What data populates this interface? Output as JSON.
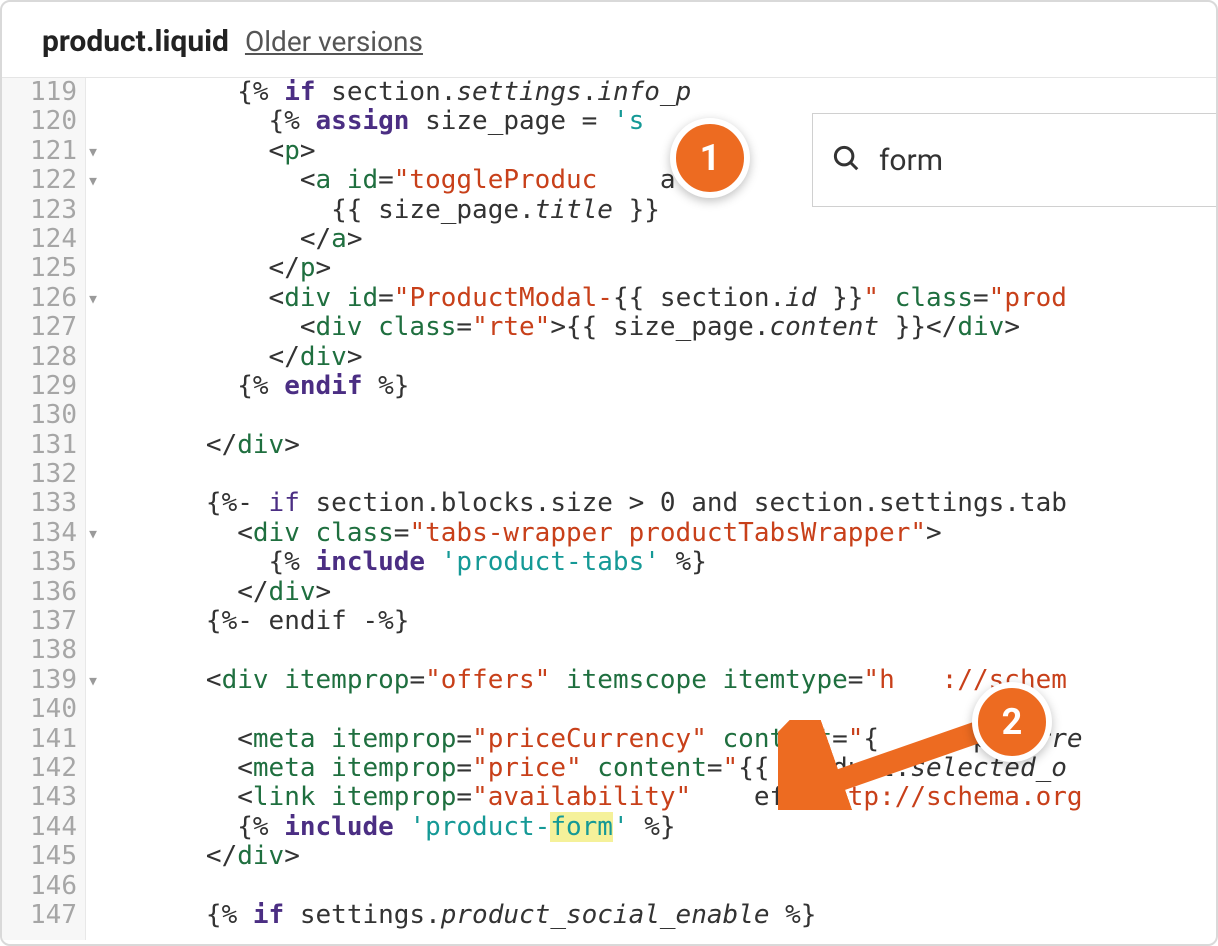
{
  "header": {
    "filename": "product.liquid",
    "older_versions": "Older versions"
  },
  "search": {
    "value": "form"
  },
  "annotations": {
    "badge1": "1",
    "badge2": "2"
  },
  "gutter": {
    "start": 119,
    "end": 147,
    "fold_arrows": [
      121,
      122,
      126,
      134,
      139
    ]
  },
  "code": {
    "lines": [
      {
        "n": 119,
        "indent": 8,
        "tokens": [
          [
            "ang",
            "{% "
          ],
          [
            "kw",
            "if"
          ],
          [
            "ang",
            " section."
          ],
          [
            "prop",
            "settings"
          ],
          [
            "ang",
            "."
          ],
          [
            "prop",
            "info_p"
          ]
        ]
      },
      {
        "n": 120,
        "indent": 10,
        "tokens": [
          [
            "ang",
            "{% "
          ],
          [
            "kw",
            "assign"
          ],
          [
            "ang",
            " size_page = "
          ],
          [
            "str2",
            "'s"
          ]
        ]
      },
      {
        "n": 121,
        "indent": 10,
        "tokens": [
          [
            "ang",
            "<"
          ],
          [
            "tag",
            "p"
          ],
          [
            "ang",
            ">"
          ]
        ]
      },
      {
        "n": 122,
        "indent": 12,
        "tokens": [
          [
            "ang",
            "<"
          ],
          [
            "tag",
            "a"
          ],
          [
            "ang",
            " "
          ],
          [
            "attr",
            "id"
          ],
          [
            "ang",
            "="
          ],
          [
            "str",
            "\"toggleProduc"
          ],
          [
            "ang",
            "    al-"
          ]
        ]
      },
      {
        "n": 123,
        "indent": 14,
        "tokens": [
          [
            "ang",
            "{{ size_page."
          ],
          [
            "prop",
            "title"
          ],
          [
            "ang",
            " }}"
          ]
        ]
      },
      {
        "n": 124,
        "indent": 12,
        "tokens": [
          [
            "ang",
            "</"
          ],
          [
            "tag",
            "a"
          ],
          [
            "ang",
            ">"
          ]
        ]
      },
      {
        "n": 125,
        "indent": 10,
        "tokens": [
          [
            "ang",
            "</"
          ],
          [
            "tag",
            "p"
          ],
          [
            "ang",
            ">"
          ]
        ]
      },
      {
        "n": 126,
        "indent": 10,
        "tokens": [
          [
            "ang",
            "<"
          ],
          [
            "tag",
            "div"
          ],
          [
            "ang",
            " "
          ],
          [
            "attr",
            "id"
          ],
          [
            "ang",
            "="
          ],
          [
            "str",
            "\"ProductModal-"
          ],
          [
            "ang",
            "{{ section."
          ],
          [
            "prop",
            "id"
          ],
          [
            "ang",
            " }}"
          ],
          [
            "str",
            "\""
          ],
          [
            "ang",
            " "
          ],
          [
            "attr",
            "class"
          ],
          [
            "ang",
            "="
          ],
          [
            "str",
            "\"prod"
          ]
        ]
      },
      {
        "n": 127,
        "indent": 12,
        "tokens": [
          [
            "ang",
            "<"
          ],
          [
            "tag",
            "div"
          ],
          [
            "ang",
            " "
          ],
          [
            "attr",
            "class"
          ],
          [
            "ang",
            "="
          ],
          [
            "str",
            "\"rte\""
          ],
          [
            "ang",
            ">{{ size_page."
          ],
          [
            "prop",
            "content"
          ],
          [
            "ang",
            " }}</"
          ],
          [
            "tag",
            "div"
          ],
          [
            "ang",
            ">"
          ]
        ]
      },
      {
        "n": 128,
        "indent": 10,
        "tokens": [
          [
            "ang",
            "</"
          ],
          [
            "tag",
            "div"
          ],
          [
            "ang",
            ">"
          ]
        ]
      },
      {
        "n": 129,
        "indent": 8,
        "tokens": [
          [
            "ang",
            "{% "
          ],
          [
            "kw",
            "endif"
          ],
          [
            "ang",
            " %}"
          ]
        ]
      },
      {
        "n": 130,
        "indent": 0,
        "tokens": []
      },
      {
        "n": 131,
        "indent": 6,
        "tokens": [
          [
            "ang",
            "</"
          ],
          [
            "tag",
            "div"
          ],
          [
            "ang",
            ">"
          ]
        ]
      },
      {
        "n": 132,
        "indent": 0,
        "tokens": []
      },
      {
        "n": 133,
        "indent": 6,
        "tokens": [
          [
            "ang",
            "{%- "
          ],
          [
            "lt",
            "if"
          ],
          [
            "ang",
            " section.blocks.size > 0 and section.settings.tab"
          ]
        ]
      },
      {
        "n": 134,
        "indent": 8,
        "tokens": [
          [
            "ang",
            "<"
          ],
          [
            "tag",
            "div"
          ],
          [
            "ang",
            " "
          ],
          [
            "attr",
            "class"
          ],
          [
            "ang",
            "="
          ],
          [
            "str",
            "\"tabs-wrapper productTabsWrapper\""
          ],
          [
            "ang",
            ">"
          ]
        ]
      },
      {
        "n": 135,
        "indent": 10,
        "tokens": [
          [
            "ang",
            "{% "
          ],
          [
            "kw",
            "include"
          ],
          [
            "ang",
            " "
          ],
          [
            "str2",
            "'product-tabs'"
          ],
          [
            "ang",
            " %}"
          ]
        ]
      },
      {
        "n": 136,
        "indent": 8,
        "tokens": [
          [
            "ang",
            "</"
          ],
          [
            "tag",
            "div"
          ],
          [
            "ang",
            ">"
          ]
        ]
      },
      {
        "n": 137,
        "indent": 6,
        "tokens": [
          [
            "ang",
            "{%- endif -%}"
          ]
        ]
      },
      {
        "n": 138,
        "indent": 0,
        "tokens": []
      },
      {
        "n": 139,
        "indent": 6,
        "tokens": [
          [
            "ang",
            "<"
          ],
          [
            "tag",
            "div"
          ],
          [
            "ang",
            " "
          ],
          [
            "attr",
            "itemprop"
          ],
          [
            "ang",
            "="
          ],
          [
            "str",
            "\"offers\""
          ],
          [
            "ang",
            " "
          ],
          [
            "attr",
            "itemscope"
          ],
          [
            "ang",
            " "
          ],
          [
            "attr",
            "itemtype"
          ],
          [
            "ang",
            "="
          ],
          [
            "str",
            "\"h   ://schem"
          ]
        ]
      },
      {
        "n": 140,
        "indent": 0,
        "tokens": []
      },
      {
        "n": 141,
        "indent": 8,
        "tokens": [
          [
            "ang",
            "<"
          ],
          [
            "tag",
            "meta"
          ],
          [
            "ang",
            " "
          ],
          [
            "attr",
            "itemprop"
          ],
          [
            "ang",
            "="
          ],
          [
            "str",
            "\"priceCurrency\""
          ],
          [
            "ang",
            " "
          ],
          [
            "attr",
            "content"
          ],
          [
            "ang",
            "="
          ],
          [
            "str",
            "\""
          ],
          [
            "ang",
            "{      p."
          ],
          [
            "prop",
            "curre"
          ]
        ]
      },
      {
        "n": 142,
        "indent": 8,
        "tokens": [
          [
            "ang",
            "<"
          ],
          [
            "tag",
            "meta"
          ],
          [
            "ang",
            " "
          ],
          [
            "attr",
            "itemprop"
          ],
          [
            "ang",
            "="
          ],
          [
            "str",
            "\"price\""
          ],
          [
            "ang",
            " "
          ],
          [
            "attr",
            "content"
          ],
          [
            "ang",
            "="
          ],
          [
            "str",
            "\""
          ],
          [
            "ang",
            "{{  roduct."
          ],
          [
            "prop",
            "selected_o"
          ]
        ]
      },
      {
        "n": 143,
        "indent": 8,
        "tokens": [
          [
            "ang",
            "<"
          ],
          [
            "tag",
            "link"
          ],
          [
            "ang",
            " "
          ],
          [
            "attr",
            "itemprop"
          ],
          [
            "ang",
            "="
          ],
          [
            "str",
            "\"availability\""
          ],
          [
            "ang",
            "    ef="
          ],
          [
            "str",
            "\"http://schema.org"
          ]
        ]
      },
      {
        "n": 144,
        "indent": 8,
        "tokens": [
          [
            "ang",
            "{% "
          ],
          [
            "kw",
            "include"
          ],
          [
            "ang",
            " "
          ],
          [
            "str2",
            "'product-"
          ],
          [
            "hl",
            "form"
          ],
          [
            "str2",
            "'"
          ],
          [
            "ang",
            " %}"
          ]
        ]
      },
      {
        "n": 145,
        "indent": 6,
        "tokens": [
          [
            "ang",
            "</"
          ],
          [
            "tag",
            "div"
          ],
          [
            "ang",
            ">"
          ]
        ]
      },
      {
        "n": 146,
        "indent": 0,
        "tokens": []
      },
      {
        "n": 147,
        "indent": 6,
        "tokens": [
          [
            "ang",
            "{% "
          ],
          [
            "kw",
            "if"
          ],
          [
            "ang",
            " settings."
          ],
          [
            "prop",
            "product_social_enable"
          ],
          [
            "ang",
            " %}"
          ]
        ]
      }
    ]
  }
}
